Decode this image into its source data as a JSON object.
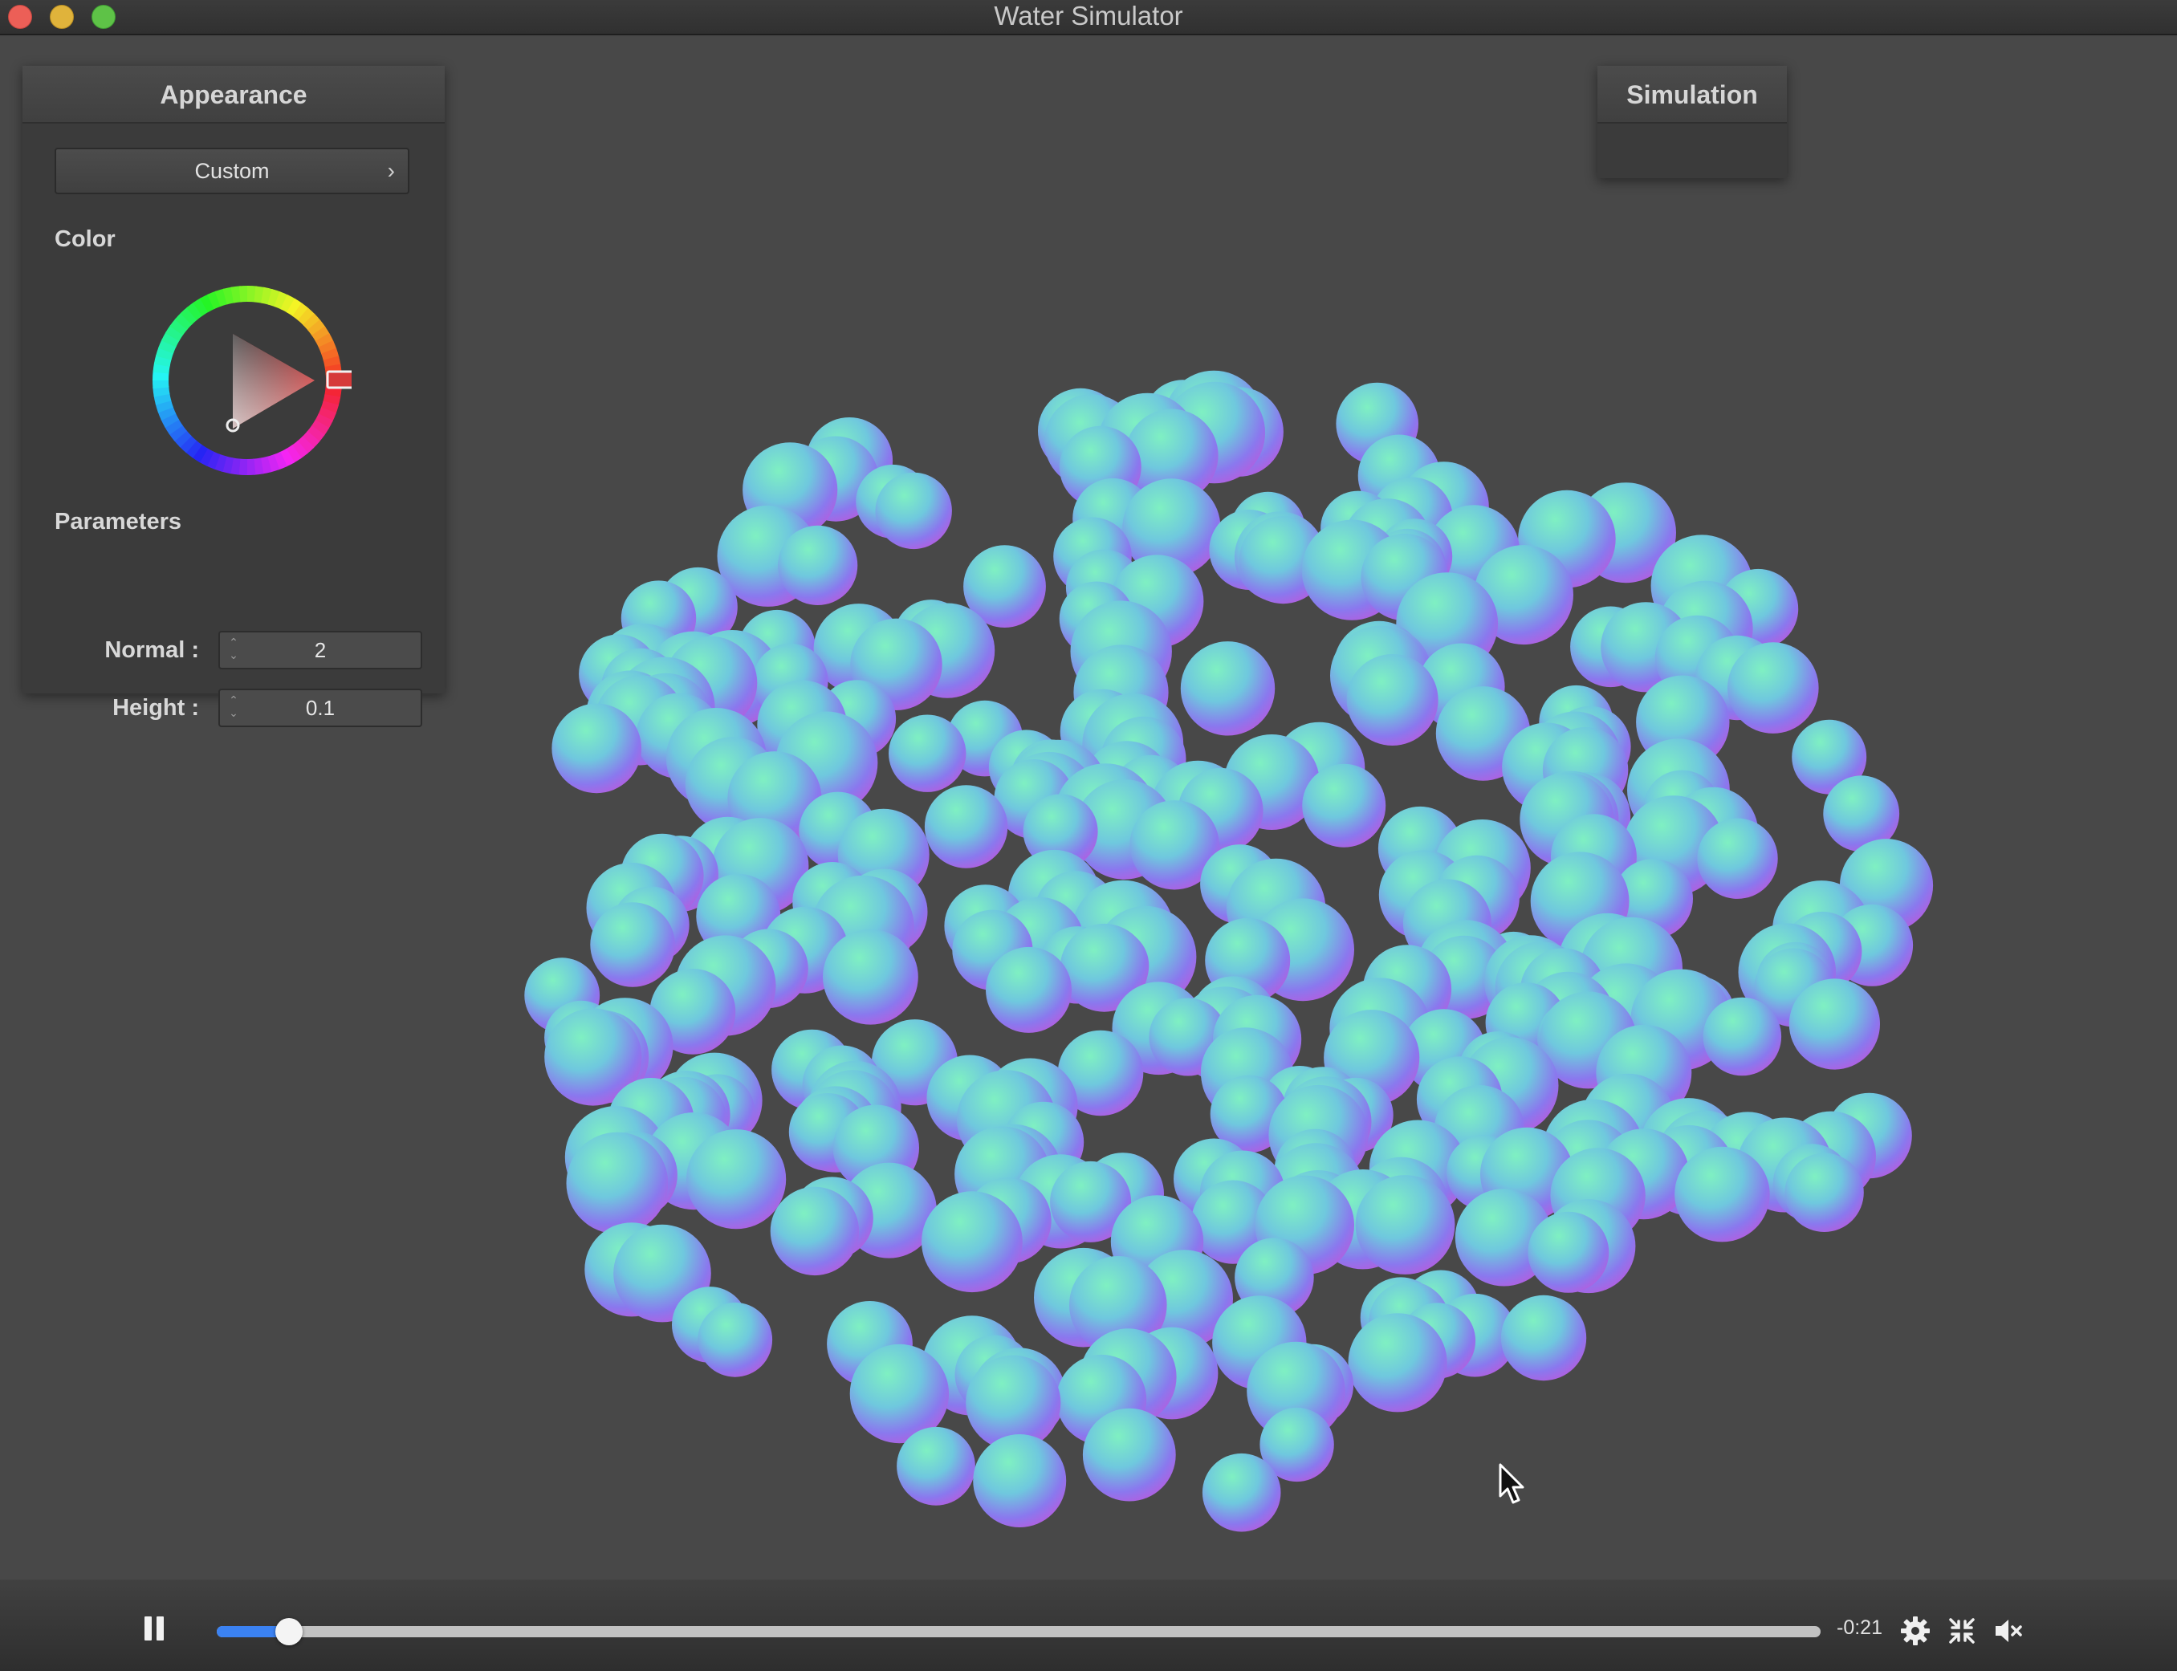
{
  "window": {
    "title": "Water Simulator"
  },
  "appearance_panel": {
    "title": "Appearance",
    "preset": {
      "label": "Custom",
      "chevron": "›"
    },
    "color_label": "Color",
    "color": "#d63a3a",
    "parameters_label": "Parameters",
    "normal": {
      "label": "Normal :",
      "value": "2"
    },
    "height": {
      "label": "Height :",
      "value": "0.1"
    }
  },
  "simulation_panel": {
    "title": "Simulation"
  },
  "playback": {
    "progress": 0.045,
    "time_remaining": "-0:21",
    "icons": [
      "pause-icon",
      "gear-icon",
      "exit-fullscreen-icon",
      "speaker-muted-icon"
    ]
  },
  "colors": {
    "background": "#474747",
    "panel": "#3b3b3b",
    "accent": "#3b82f2",
    "particle_a": "#6ee9b8",
    "particle_b": "#8a7df0",
    "particle_c": "#b066e6"
  }
}
